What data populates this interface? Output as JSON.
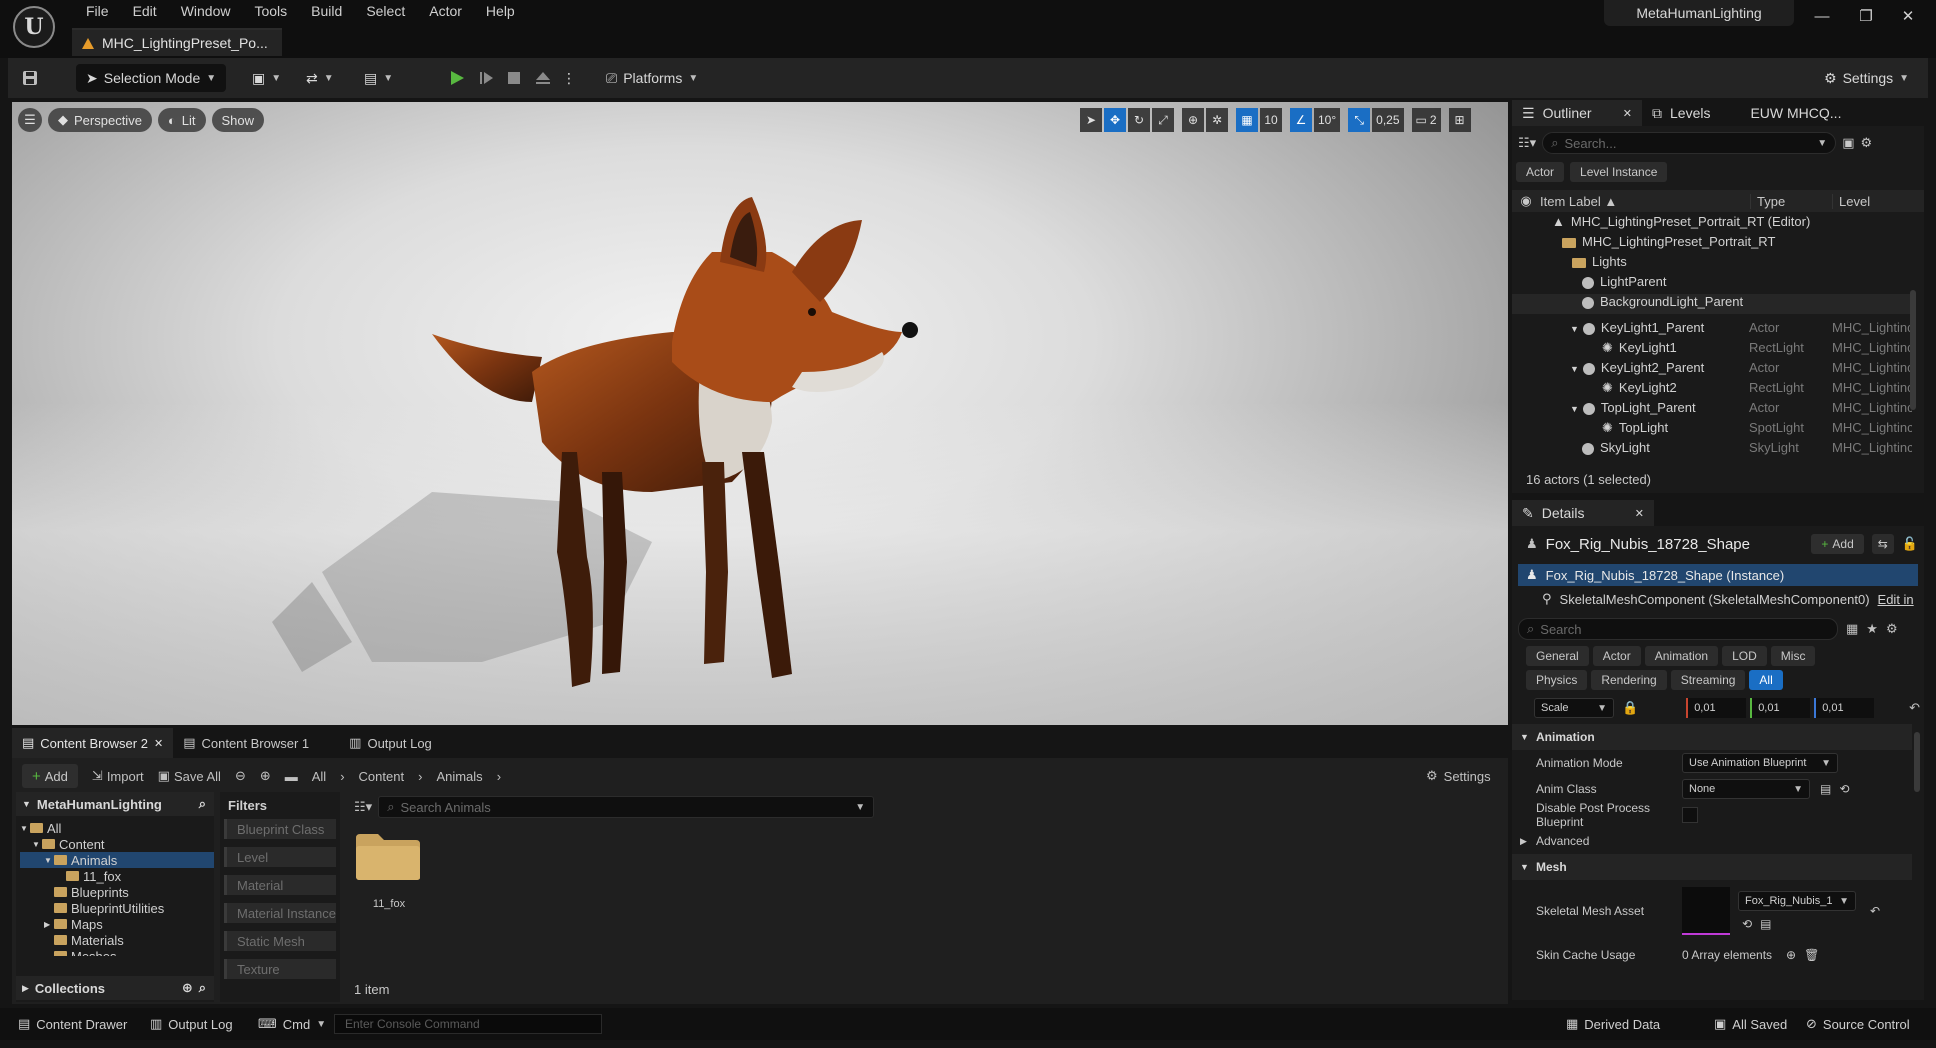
{
  "app": {
    "menu": [
      "File",
      "Edit",
      "Window",
      "Tools",
      "Build",
      "Select",
      "Actor",
      "Help"
    ],
    "document_tab": "MHC_LightingPreset_Po...",
    "project_name": "MetaHumanLighting",
    "window_controls": {
      "minimize": "—",
      "restore": "❐",
      "close": "✕"
    }
  },
  "toolbar": {
    "selection_mode": "Selection Mode",
    "platforms": "Platforms",
    "settings": "Settings"
  },
  "viewport": {
    "perspective": "Perspective",
    "lit": "Lit",
    "show": "Show",
    "grid_snap": "10",
    "angle_snap": "10°",
    "scale_snap": "0,25",
    "camera_speed": "2"
  },
  "outliner": {
    "tab_outliner": "Outliner",
    "tab_levels": "Levels",
    "tab_extra": "EUW MHCQ...",
    "search_placeholder": "Search...",
    "chips": [
      "Actor",
      "Level Instance"
    ],
    "columns": {
      "label": "Item Label ▲",
      "type": "Type",
      "level": "Level"
    },
    "rows": [
      {
        "label": "MHC_LightingPreset_Portrait_RT (Editor)",
        "type": "",
        "level": ""
      },
      {
        "label": "MHC_LightingPreset_Portrait_RT",
        "type": "",
        "level": ""
      },
      {
        "label": "Lights",
        "type": "",
        "level": ""
      },
      {
        "label": "LightParent",
        "type": "",
        "level": ""
      },
      {
        "label": "BackgroundLight_Parent",
        "type": "",
        "level": ""
      },
      {
        "label": "KeyLight1_Parent",
        "type": "Actor",
        "level": "MHC_Lightinc"
      },
      {
        "label": "KeyLight1",
        "type": "RectLight",
        "level": "MHC_Lightinc"
      },
      {
        "label": "KeyLight2_Parent",
        "type": "Actor",
        "level": "MHC_Lightinc"
      },
      {
        "label": "KeyLight2",
        "type": "RectLight",
        "level": "MHC_Lightinc"
      },
      {
        "label": "TopLight_Parent",
        "type": "Actor",
        "level": "MHC_Lightinc"
      },
      {
        "label": "TopLight",
        "type": "SpotLight",
        "level": "MHC_Lightinc"
      },
      {
        "label": "SkyLight",
        "type": "SkyLight",
        "level": "MHC_Lightinc"
      }
    ],
    "status": "16 actors (1 selected)"
  },
  "details": {
    "tab": "Details",
    "actor_name": "Fox_Rig_Nubis_18728_Shape",
    "add": "Add",
    "instance": "Fox_Rig_Nubis_18728_Shape (Instance)",
    "component": "SkeletalMeshComponent (SkeletalMeshComponent0)",
    "edit_in": "Edit in",
    "search_placeholder": "Search",
    "filters_row1": [
      "General",
      "Actor",
      "Animation",
      "LOD",
      "Misc"
    ],
    "filters_row2": [
      "Physics",
      "Rendering",
      "Streaming",
      "All"
    ],
    "scale_label": "Scale",
    "scale_values": [
      "0,01",
      "0,01",
      "0,01"
    ],
    "animation_section": "Animation",
    "animation_mode_label": "Animation Mode",
    "animation_mode_value": "Use Animation Blueprint",
    "anim_class_label": "Anim Class",
    "anim_class_value": "None",
    "disable_pp_label": "Disable Post Process Blueprint",
    "advanced": "Advanced",
    "mesh_section": "Mesh",
    "skeletal_mesh_label": "Skeletal Mesh Asset",
    "skeletal_mesh_value": "Fox_Rig_Nubis_1",
    "skin_cache_label": "Skin Cache Usage",
    "skin_cache_value": "0 Array elements"
  },
  "content_browser": {
    "tabs": [
      "Content Browser 2",
      "Content Browser 1",
      "Output Log"
    ],
    "add": "Add",
    "import": "Import",
    "save_all": "Save All",
    "breadcrumb": [
      "All",
      "Content",
      "Animals"
    ],
    "settings": "Settings",
    "project_root": "MetaHumanLighting",
    "tree": [
      {
        "label": "All",
        "indent": 0,
        "arrow": "▼"
      },
      {
        "label": "Content",
        "indent": 1,
        "arrow": "▼"
      },
      {
        "label": "Animals",
        "indent": 2,
        "arrow": "▼"
      },
      {
        "label": "11_fox",
        "indent": 3,
        "arrow": ""
      },
      {
        "label": "Blueprints",
        "indent": 2,
        "arrow": ""
      },
      {
        "label": "BlueprintUtilities",
        "indent": 2,
        "arrow": ""
      },
      {
        "label": "Maps",
        "indent": 2,
        "arrow": "▶"
      },
      {
        "label": "Materials",
        "indent": 2,
        "arrow": ""
      },
      {
        "label": "Meshes",
        "indent": 2,
        "arrow": ""
      }
    ],
    "collections": "Collections",
    "filters_title": "Filters",
    "filters": [
      "Blueprint Class",
      "Level",
      "Material",
      "Material Instance",
      "Static Mesh",
      "Texture"
    ],
    "search_placeholder": "Search Animals",
    "asset_name": "11_fox",
    "item_count": "1 item"
  },
  "statusbar": {
    "content_drawer": "Content Drawer",
    "output_log": "Output Log",
    "cmd": "Cmd",
    "console_placeholder": "Enter Console Command",
    "derived_data": "Derived Data",
    "all_saved": "All Saved",
    "source_control": "Source Control"
  }
}
